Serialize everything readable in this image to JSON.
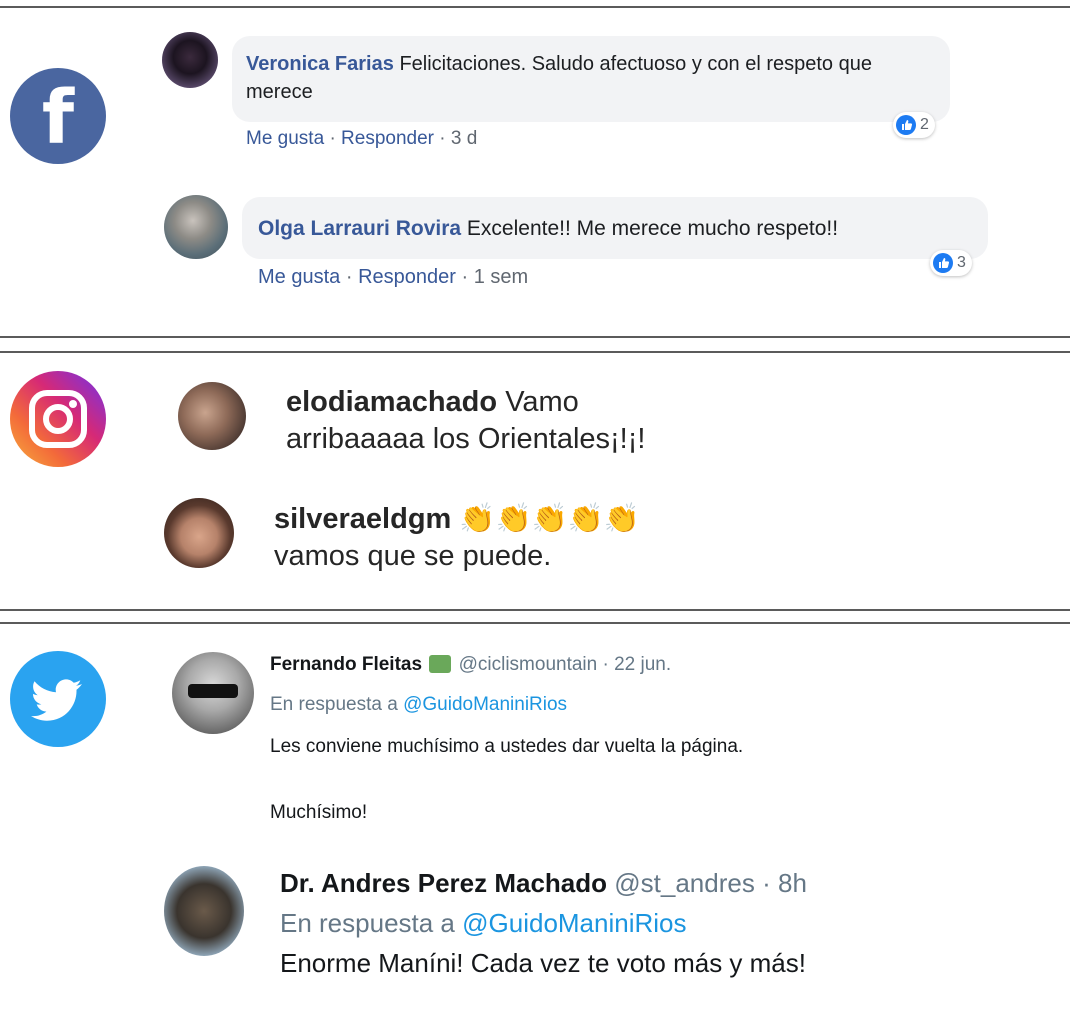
{
  "facebook": {
    "logo_letter": "f",
    "comments": [
      {
        "author": "Veronica Farias",
        "text": "Felicitaciones. Saludo afectuoso y con el respeto que merece",
        "like_label": "Me gusta",
        "reply_label": "Responder",
        "time": "3 d",
        "reactions": "2"
      },
      {
        "author": "Olga Larrauri Rovira",
        "text": "Excelente!! Me merece mucho respeto!!",
        "like_label": "Me gusta",
        "reply_label": "Responder",
        "time": "1 sem",
        "reactions": "3"
      }
    ]
  },
  "instagram": {
    "comments": [
      {
        "username": "elodiamachado",
        "text": "Vamo",
        "text2": "arribaaaaa los Orientales¡!¡!"
      },
      {
        "username": "silveraeldgm",
        "emoji": "👏👏👏👏👏",
        "text2": "vamos que se puede."
      }
    ]
  },
  "twitter": {
    "tweets": [
      {
        "name": "Fernando Fleitas",
        "handle": "@ciclismountain",
        "time": "22 jun.",
        "reply_prefix": "En respuesta a",
        "reply_to": "@GuidoManiniRios",
        "text1": "Les conviene muchísimo a ustedes dar vuelta la página.",
        "text2": "Muchísimo!"
      },
      {
        "name": "Dr. Andres Perez Machado",
        "handle": "@st_andres",
        "time": "8h",
        "reply_prefix": "En respuesta a",
        "reply_to": "@GuidoManiniRios",
        "text1": "Enorme Maníni! Cada vez te voto más y más!"
      }
    ]
  },
  "colors": {
    "facebook_blue": "#4a66a0",
    "facebook_link": "#385898",
    "twitter_blue": "#2aa3f0",
    "twitter_link": "#1b95e0"
  }
}
